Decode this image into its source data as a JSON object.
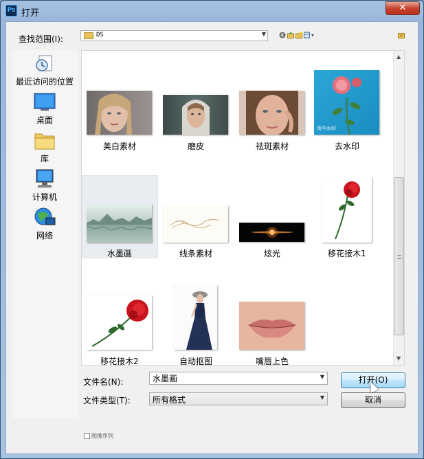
{
  "window": {
    "title": "打开",
    "app_icon": "Ps",
    "close_glyph": "✕"
  },
  "toolbar": {
    "look_in_label": "查找范围(I):",
    "look_in_value": "DS",
    "tools": [
      "back-icon",
      "up-folder-icon",
      "new-folder-icon",
      "view-menu-icon"
    ]
  },
  "places": [
    {
      "label": "最近访问的位置",
      "icon": "recent-places-icon"
    },
    {
      "label": "桌面",
      "icon": "desktop-icon"
    },
    {
      "label": "库",
      "icon": "libraries-icon"
    },
    {
      "label": "计算机",
      "icon": "computer-icon"
    },
    {
      "label": "网络",
      "icon": "network-icon"
    }
  ],
  "files": [
    {
      "name": "美白素材",
      "thumb": "portrait-blonde"
    },
    {
      "name": "磨皮",
      "thumb": "portrait-hood"
    },
    {
      "name": "祛斑素材",
      "thumb": "portrait-freckles"
    },
    {
      "name": "去水印",
      "thumb": "pink-rose",
      "watermark": "青华水印"
    },
    {
      "name": "水墨画",
      "thumb": "ink-landscape",
      "selected": true
    },
    {
      "name": "线条素材",
      "thumb": "gold-lines"
    },
    {
      "name": "炫光",
      "thumb": "lens-flare"
    },
    {
      "name": "移花接木1",
      "thumb": "red-rose-vertical"
    },
    {
      "name": "移花接木2",
      "thumb": "red-rose-horizontal"
    },
    {
      "name": "自动抠图",
      "thumb": "woman-dress"
    },
    {
      "name": "嘴唇上色",
      "thumb": "lips"
    }
  ],
  "form": {
    "filename_label": "文件名(N):",
    "filename_value": "水墨画",
    "filetype_label": "文件类型(T):",
    "filetype_value": "所有格式"
  },
  "buttons": {
    "open": "打开(O)",
    "cancel": "取消"
  },
  "footer": {
    "image_sequence_label": "图像序列"
  }
}
